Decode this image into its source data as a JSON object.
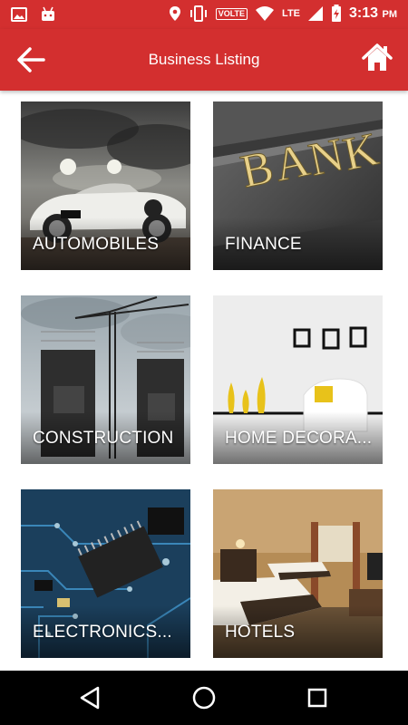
{
  "status_bar": {
    "network_badge": "VOLTE",
    "network_type": "LTE",
    "time": "3:13",
    "ampm": "PM",
    "icons": [
      "gallery-icon",
      "android-icon",
      "location-icon",
      "vibrate-icon",
      "wifi-icon",
      "signal-icon",
      "battery-charging-icon"
    ]
  },
  "app_bar": {
    "title": "Business Listing",
    "back_icon": "back-arrow-icon",
    "home_icon": "home-icon"
  },
  "categories": [
    {
      "label": "AUTOMOBILES"
    },
    {
      "label": "FINANCE"
    },
    {
      "label": "CONSTRUCTION"
    },
    {
      "label": "HOME DECORA..."
    },
    {
      "label": "ELECTRONICS..."
    },
    {
      "label": "HOTELS"
    }
  ],
  "nav_bar": {
    "icons": [
      "nav-back-icon",
      "nav-home-icon",
      "nav-recents-icon"
    ]
  },
  "colors": {
    "primary": "#d32f2f",
    "nav_background": "#000000"
  }
}
